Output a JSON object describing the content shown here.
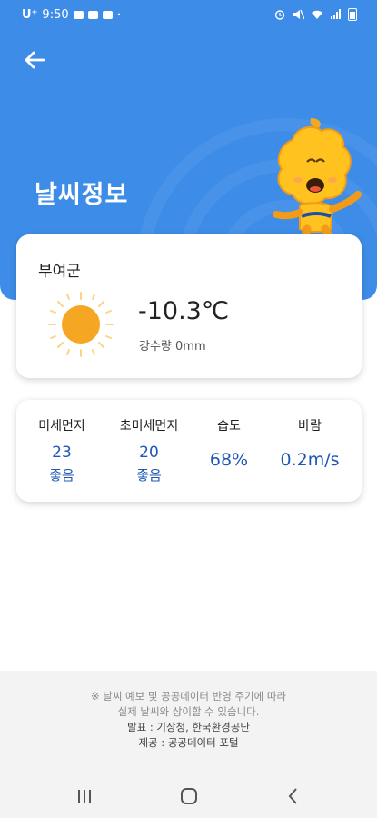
{
  "status_bar": {
    "carrier": "U⁺",
    "time": "9:50",
    "dot": "•"
  },
  "header": {
    "title": "날씨정보"
  },
  "weather": {
    "location": "부여군",
    "icon": "sun-icon",
    "temperature": "-10.3℃",
    "precipitation": "강수량 0mm"
  },
  "air_quality": [
    {
      "label": "미세먼지",
      "value": "23",
      "status": "좋음"
    },
    {
      "label": "초미세먼지",
      "value": "20",
      "status": "좋음"
    },
    {
      "label": "습도",
      "value": "68%"
    },
    {
      "label": "바람",
      "value": "0.2m/s"
    }
  ],
  "footer": {
    "note_line1": "※ 날씨 예보 및 공공데이터 반영 주기에 따라",
    "note_line2": "실제 날씨와 상이할 수 있습니다.",
    "source": "발표 : 기상청, 한국환경공단",
    "provider": "제공 : 공공데이터 포털"
  },
  "colors": {
    "header_blue": "#3d8de8",
    "value_blue": "#1e57b3",
    "sun": "#f5a623"
  }
}
